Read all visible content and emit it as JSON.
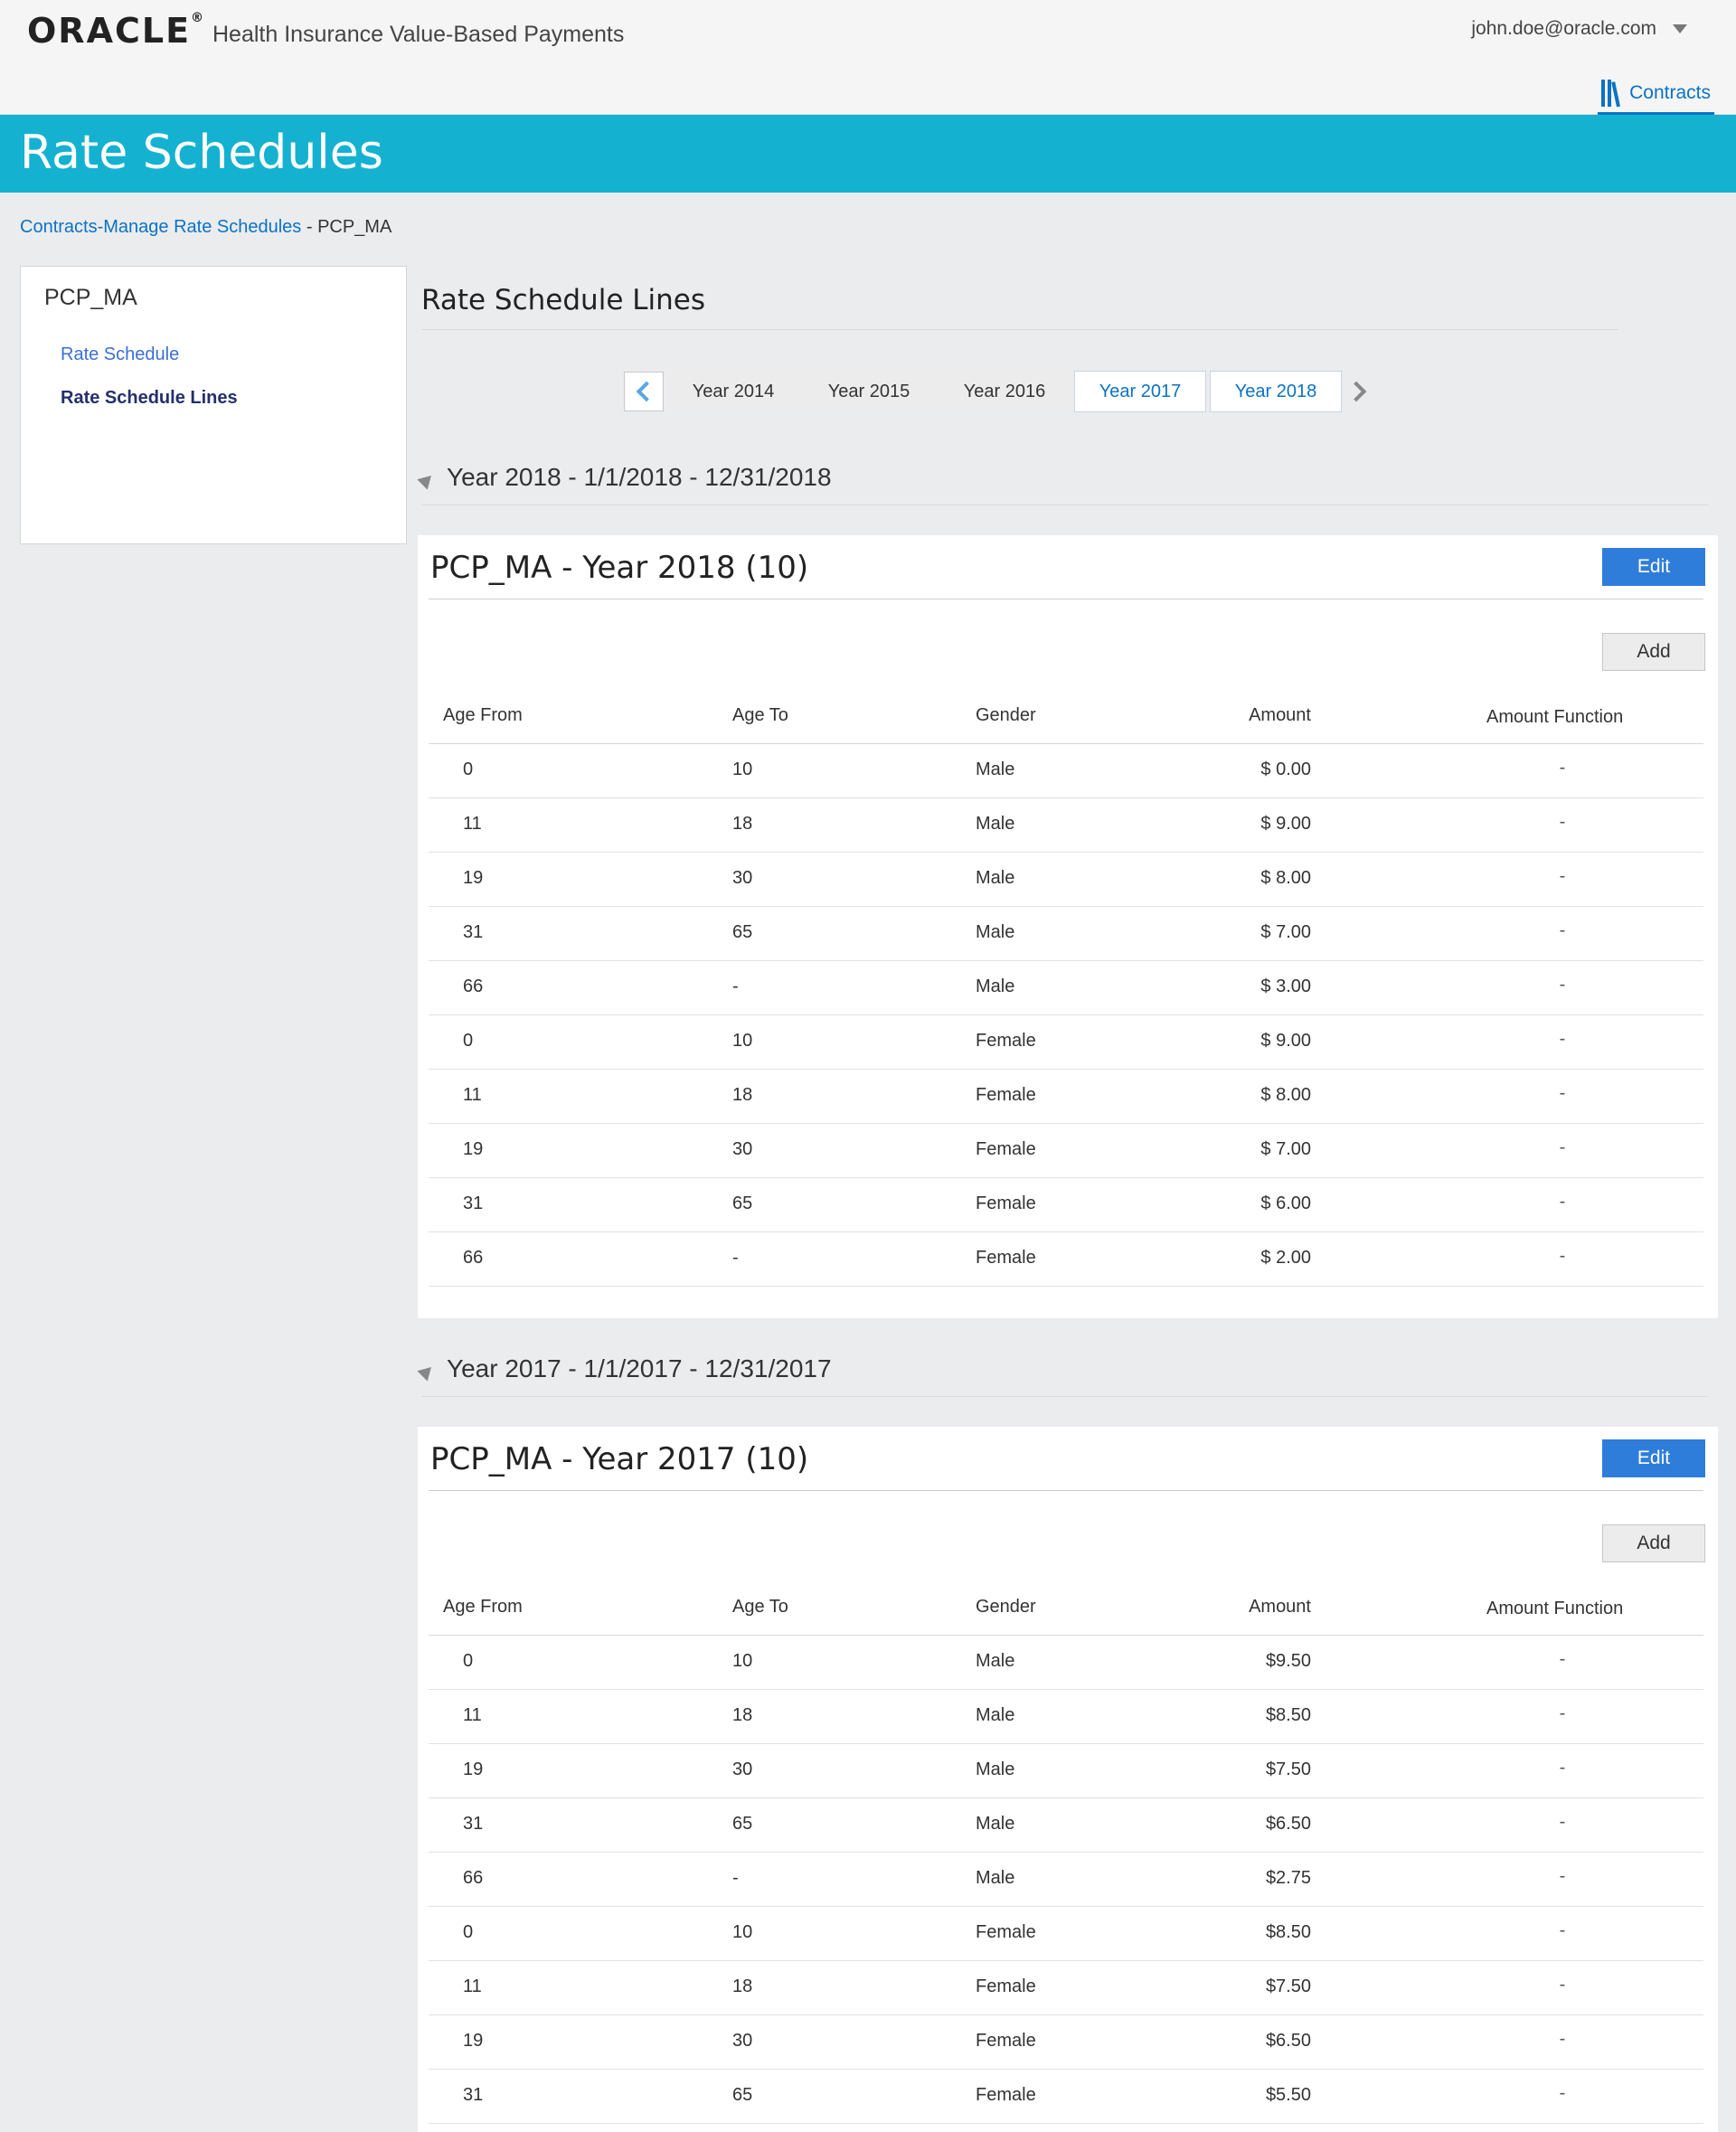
{
  "header": {
    "logo": "ORACLE",
    "app_title": "Health Insurance Value-Based Payments",
    "user": "john.doe@oracle.com",
    "nav_contracts": "Contracts"
  },
  "banner": {
    "title": "Rate Schedules"
  },
  "breadcrumb": {
    "link": "Contracts-Manage Rate Schedules",
    "separator": " - ",
    "current": "PCP_MA"
  },
  "left_panel": {
    "title": "PCP_MA",
    "items": [
      {
        "label": "Rate Schedule"
      },
      {
        "label": "Rate Schedule Lines"
      }
    ]
  },
  "main": {
    "title": "Rate Schedule Lines",
    "year_tabs": [
      {
        "label": "Year 2014"
      },
      {
        "label": "Year 2015"
      },
      {
        "label": "Year 2016"
      },
      {
        "label": "Year 2017"
      },
      {
        "label": "Year 2018"
      }
    ],
    "columns": [
      "Age From",
      "Age To",
      "Gender",
      "Amount",
      "Amount Function"
    ],
    "groups": [
      {
        "heading": "Year 2018 - 1/1/2018 - 12/31/2018",
        "card_title": "PCP_MA - Year 2018",
        "count": "(10)",
        "edit_label": "Edit",
        "add_label": "Add",
        "rows": [
          [
            "0",
            "10",
            "Male",
            "$ 0.00",
            "-"
          ],
          [
            "11",
            "18",
            "Male",
            "$ 9.00",
            "-"
          ],
          [
            "19",
            "30",
            "Male",
            "$ 8.00",
            "-"
          ],
          [
            "31",
            "65",
            "Male",
            "$ 7.00",
            "-"
          ],
          [
            "66",
            "-",
            "Male",
            "$ 3.00",
            "-"
          ],
          [
            "0",
            "10",
            "Female",
            "$ 9.00",
            "-"
          ],
          [
            "11",
            "18",
            "Female",
            "$ 8.00",
            "-"
          ],
          [
            "19",
            "30",
            "Female",
            "$ 7.00",
            "-"
          ],
          [
            "31",
            "65",
            "Female",
            "$ 6.00",
            "-"
          ],
          [
            "66",
            "-",
            "Female",
            "$ 2.00",
            "-"
          ]
        ]
      },
      {
        "heading": "Year 2017 - 1/1/2017 - 12/31/2017",
        "card_title": "PCP_MA - Year 2017",
        "count": "(10)",
        "edit_label": "Edit",
        "add_label": "Add",
        "rows": [
          [
            "0",
            "10",
            "Male",
            "$9.50",
            "-"
          ],
          [
            "11",
            "18",
            "Male",
            "$8.50",
            "-"
          ],
          [
            "19",
            "30",
            "Male",
            "$7.50",
            "-"
          ],
          [
            "31",
            "65",
            "Male",
            "$6.50",
            "-"
          ],
          [
            "66",
            "-",
            "Male",
            "$2.75",
            "-"
          ],
          [
            "0",
            "10",
            "Female",
            "$8.50",
            "-"
          ],
          [
            "11",
            "18",
            "Female",
            "$7.50",
            "-"
          ],
          [
            "19",
            "30",
            "Female",
            "$6.50",
            "-"
          ],
          [
            "31",
            "65",
            "Female",
            "$5.50",
            "-"
          ]
        ]
      }
    ]
  }
}
